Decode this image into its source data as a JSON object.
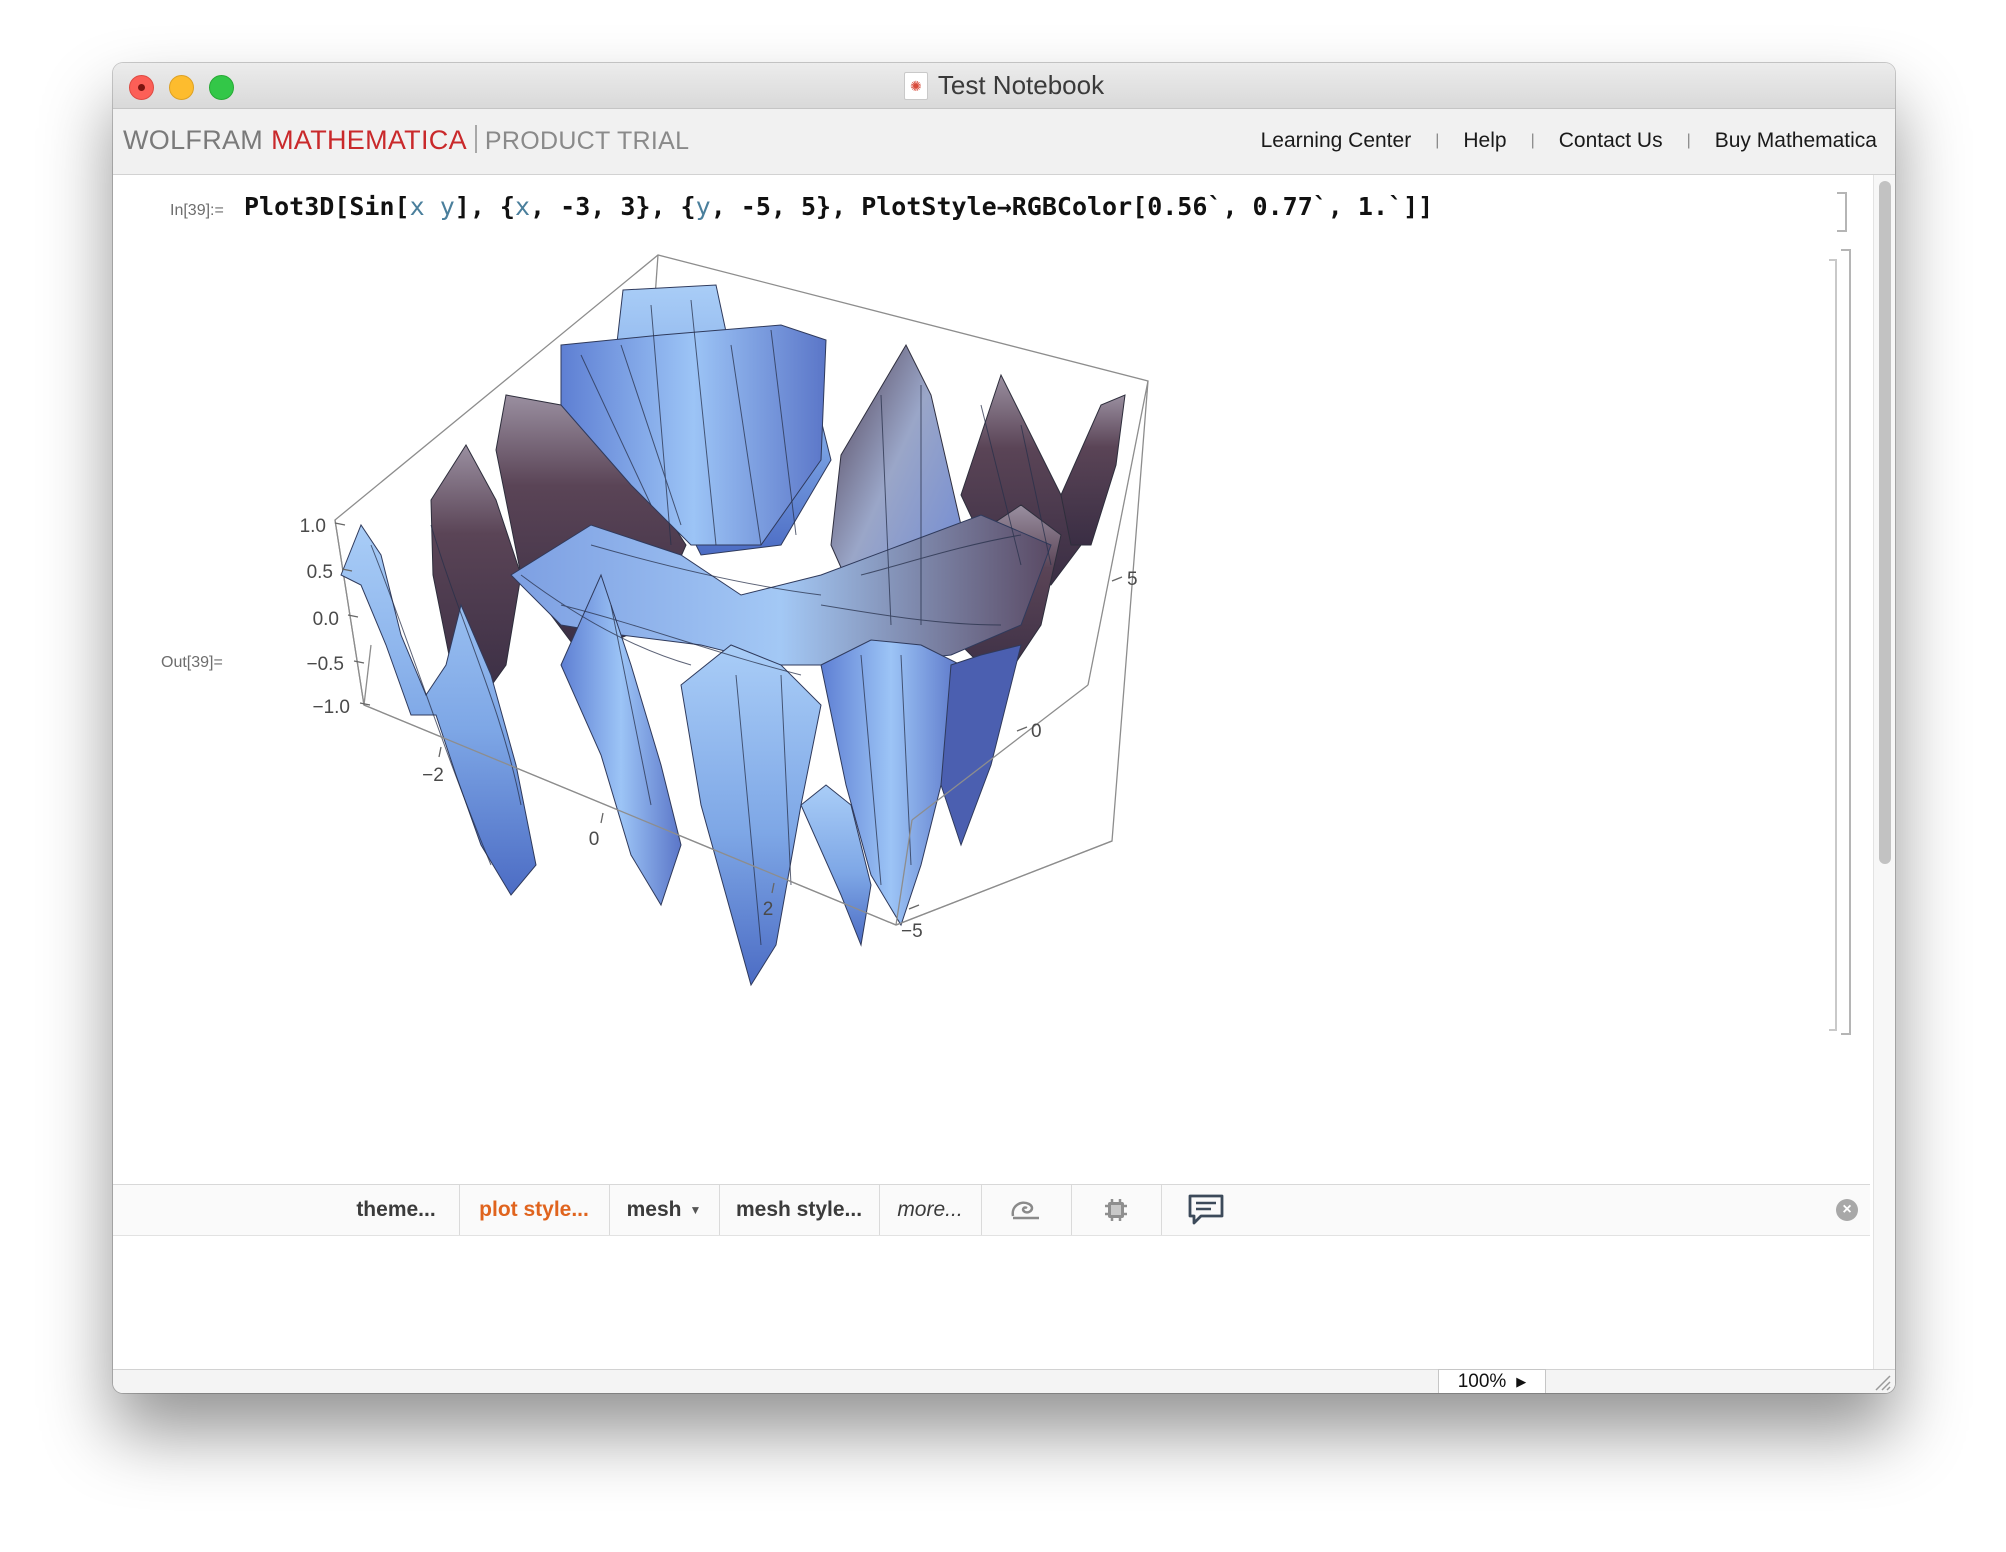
{
  "window": {
    "title": "Test Notebook",
    "doc_icon": "mathematica-notebook-icon"
  },
  "brandbar": {
    "brand_wolfram": "WOLFRAM",
    "brand_mathematica": "MATHEMATICA",
    "brand_product": "PRODUCT TRIAL",
    "brand_colors": {
      "wolfram": "#7a7a7a",
      "mathematica": "#c9292b"
    },
    "links": [
      {
        "label": "Learning Center"
      },
      {
        "label": "Help"
      },
      {
        "label": "Contact Us"
      },
      {
        "label": "Buy Mathematica"
      }
    ],
    "separator": "|"
  },
  "notebook": {
    "in_label": "In[39]:=",
    "out_label": "Out[39]=",
    "code": {
      "p1": "Plot3D[Sin[",
      "x": "x",
      "sp": " ",
      "y": "y",
      "p2": "], {",
      "x2": "x",
      "p3": ", -3, 3}, {",
      "y2": "y",
      "p4": ", -5, 5}, PlotStyle",
      "arrow": "→",
      "p5": "RGBColor[0.56`, 0.77`, 1.`]]"
    },
    "plot": {
      "surface_color": "#8fc4ff",
      "z_ticks": [
        "1.0",
        "0.5",
        "0.0",
        "−0.5",
        "−1.0"
      ],
      "x_ticks": [
        "−2",
        "0",
        "2"
      ],
      "y_ticks": [
        "5",
        "0",
        "−5"
      ]
    }
  },
  "suggestions_bar": {
    "items": [
      {
        "label": "theme..."
      },
      {
        "label": "plot style..."
      },
      {
        "label": "mesh",
        "icon": "triangle-down-icon"
      },
      {
        "label": "mesh style..."
      },
      {
        "label": "more..."
      }
    ],
    "icons": [
      "spiral-icon",
      "chip-icon",
      "chat-bubble-icon"
    ],
    "close_icon": "close-circle-icon",
    "accent": "#e0641e"
  },
  "status": {
    "zoom": "100%",
    "zoom_arrow": "▶"
  }
}
